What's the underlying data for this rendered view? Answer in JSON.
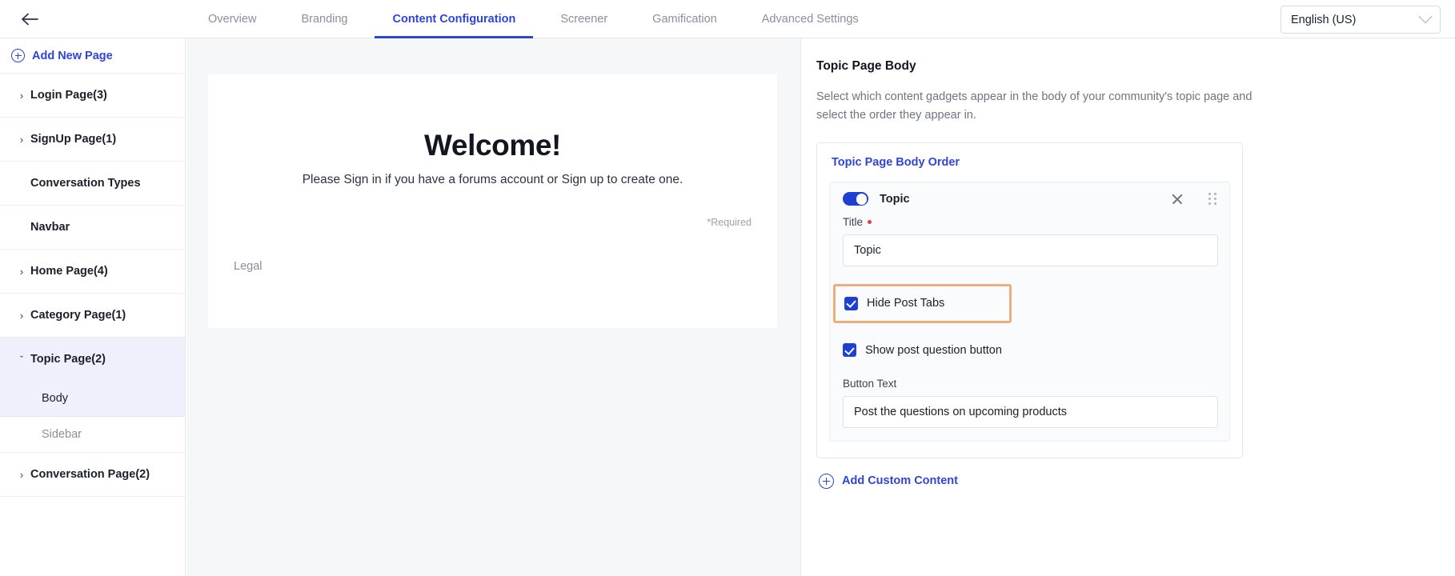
{
  "topbar": {
    "back_icon": "arrow-left-icon",
    "tabs": [
      {
        "label": "Overview",
        "active": false
      },
      {
        "label": "Branding",
        "active": false
      },
      {
        "label": "Content Configuration",
        "active": true
      },
      {
        "label": "Screener",
        "active": false
      },
      {
        "label": "Gamification",
        "active": false
      },
      {
        "label": "Advanced Settings",
        "active": false
      }
    ],
    "language": {
      "value": "English (US)",
      "chevron_icon": "chevron-down-icon"
    },
    "accent_color": "#2e45d8"
  },
  "sidebar": {
    "add_new_page": {
      "label": "Add New Page",
      "icon": "plus-circle-icon"
    },
    "items": [
      {
        "label": "Login Page(3)",
        "caret": "›",
        "expandable": true
      },
      {
        "label": "SignUp Page(1)",
        "caret": "›",
        "expandable": true
      },
      {
        "label": "Conversation Types",
        "caret": "",
        "expandable": false
      },
      {
        "label": "Navbar",
        "caret": "",
        "expandable": false
      },
      {
        "label": "Home Page(4)",
        "caret": "›",
        "expandable": true
      },
      {
        "label": "Category Page(1)",
        "caret": "›",
        "expandable": true
      },
      {
        "label": "Topic Page(2)",
        "caret": "ˇ",
        "expandable": true,
        "expanded": true,
        "highlighted": true
      },
      {
        "label": "Conversation Page(2)",
        "caret": "›",
        "expandable": true
      }
    ],
    "topic_page_children": [
      {
        "label": "Body",
        "selected": true
      },
      {
        "label": "Sidebar",
        "selected": false
      }
    ],
    "highlight_color": "#eef1fb"
  },
  "preview": {
    "title": "Welcome!",
    "subtitle": "Please Sign in if you have a forums account or Sign up to create one.",
    "required_note": "*Required",
    "legal_link": "Legal"
  },
  "right_panel": {
    "title": "Topic Page Body",
    "description": "Select which content gadgets appear in the body of your community's topic page and select the order they appear in.",
    "order_card": {
      "title": "Topic Page Body Order",
      "gadget": {
        "toggle_on": true,
        "name": "Topic",
        "close_icon": "close-icon",
        "drag_icon": "drag-handle-icon",
        "title_field": {
          "label": "Title",
          "required": true,
          "value": "Topic"
        },
        "hide_post_tabs": {
          "label": "Hide Post Tabs",
          "checked": true,
          "highlighted": true,
          "highlight_color": "#edae7c"
        },
        "show_post_question": {
          "label": "Show post question button",
          "checked": true
        },
        "button_text_field": {
          "label": "Button Text",
          "value": "Post the questions on upcoming products"
        }
      }
    },
    "add_custom_content": {
      "label": "Add Custom Content",
      "icon": "plus-circle-icon"
    }
  }
}
